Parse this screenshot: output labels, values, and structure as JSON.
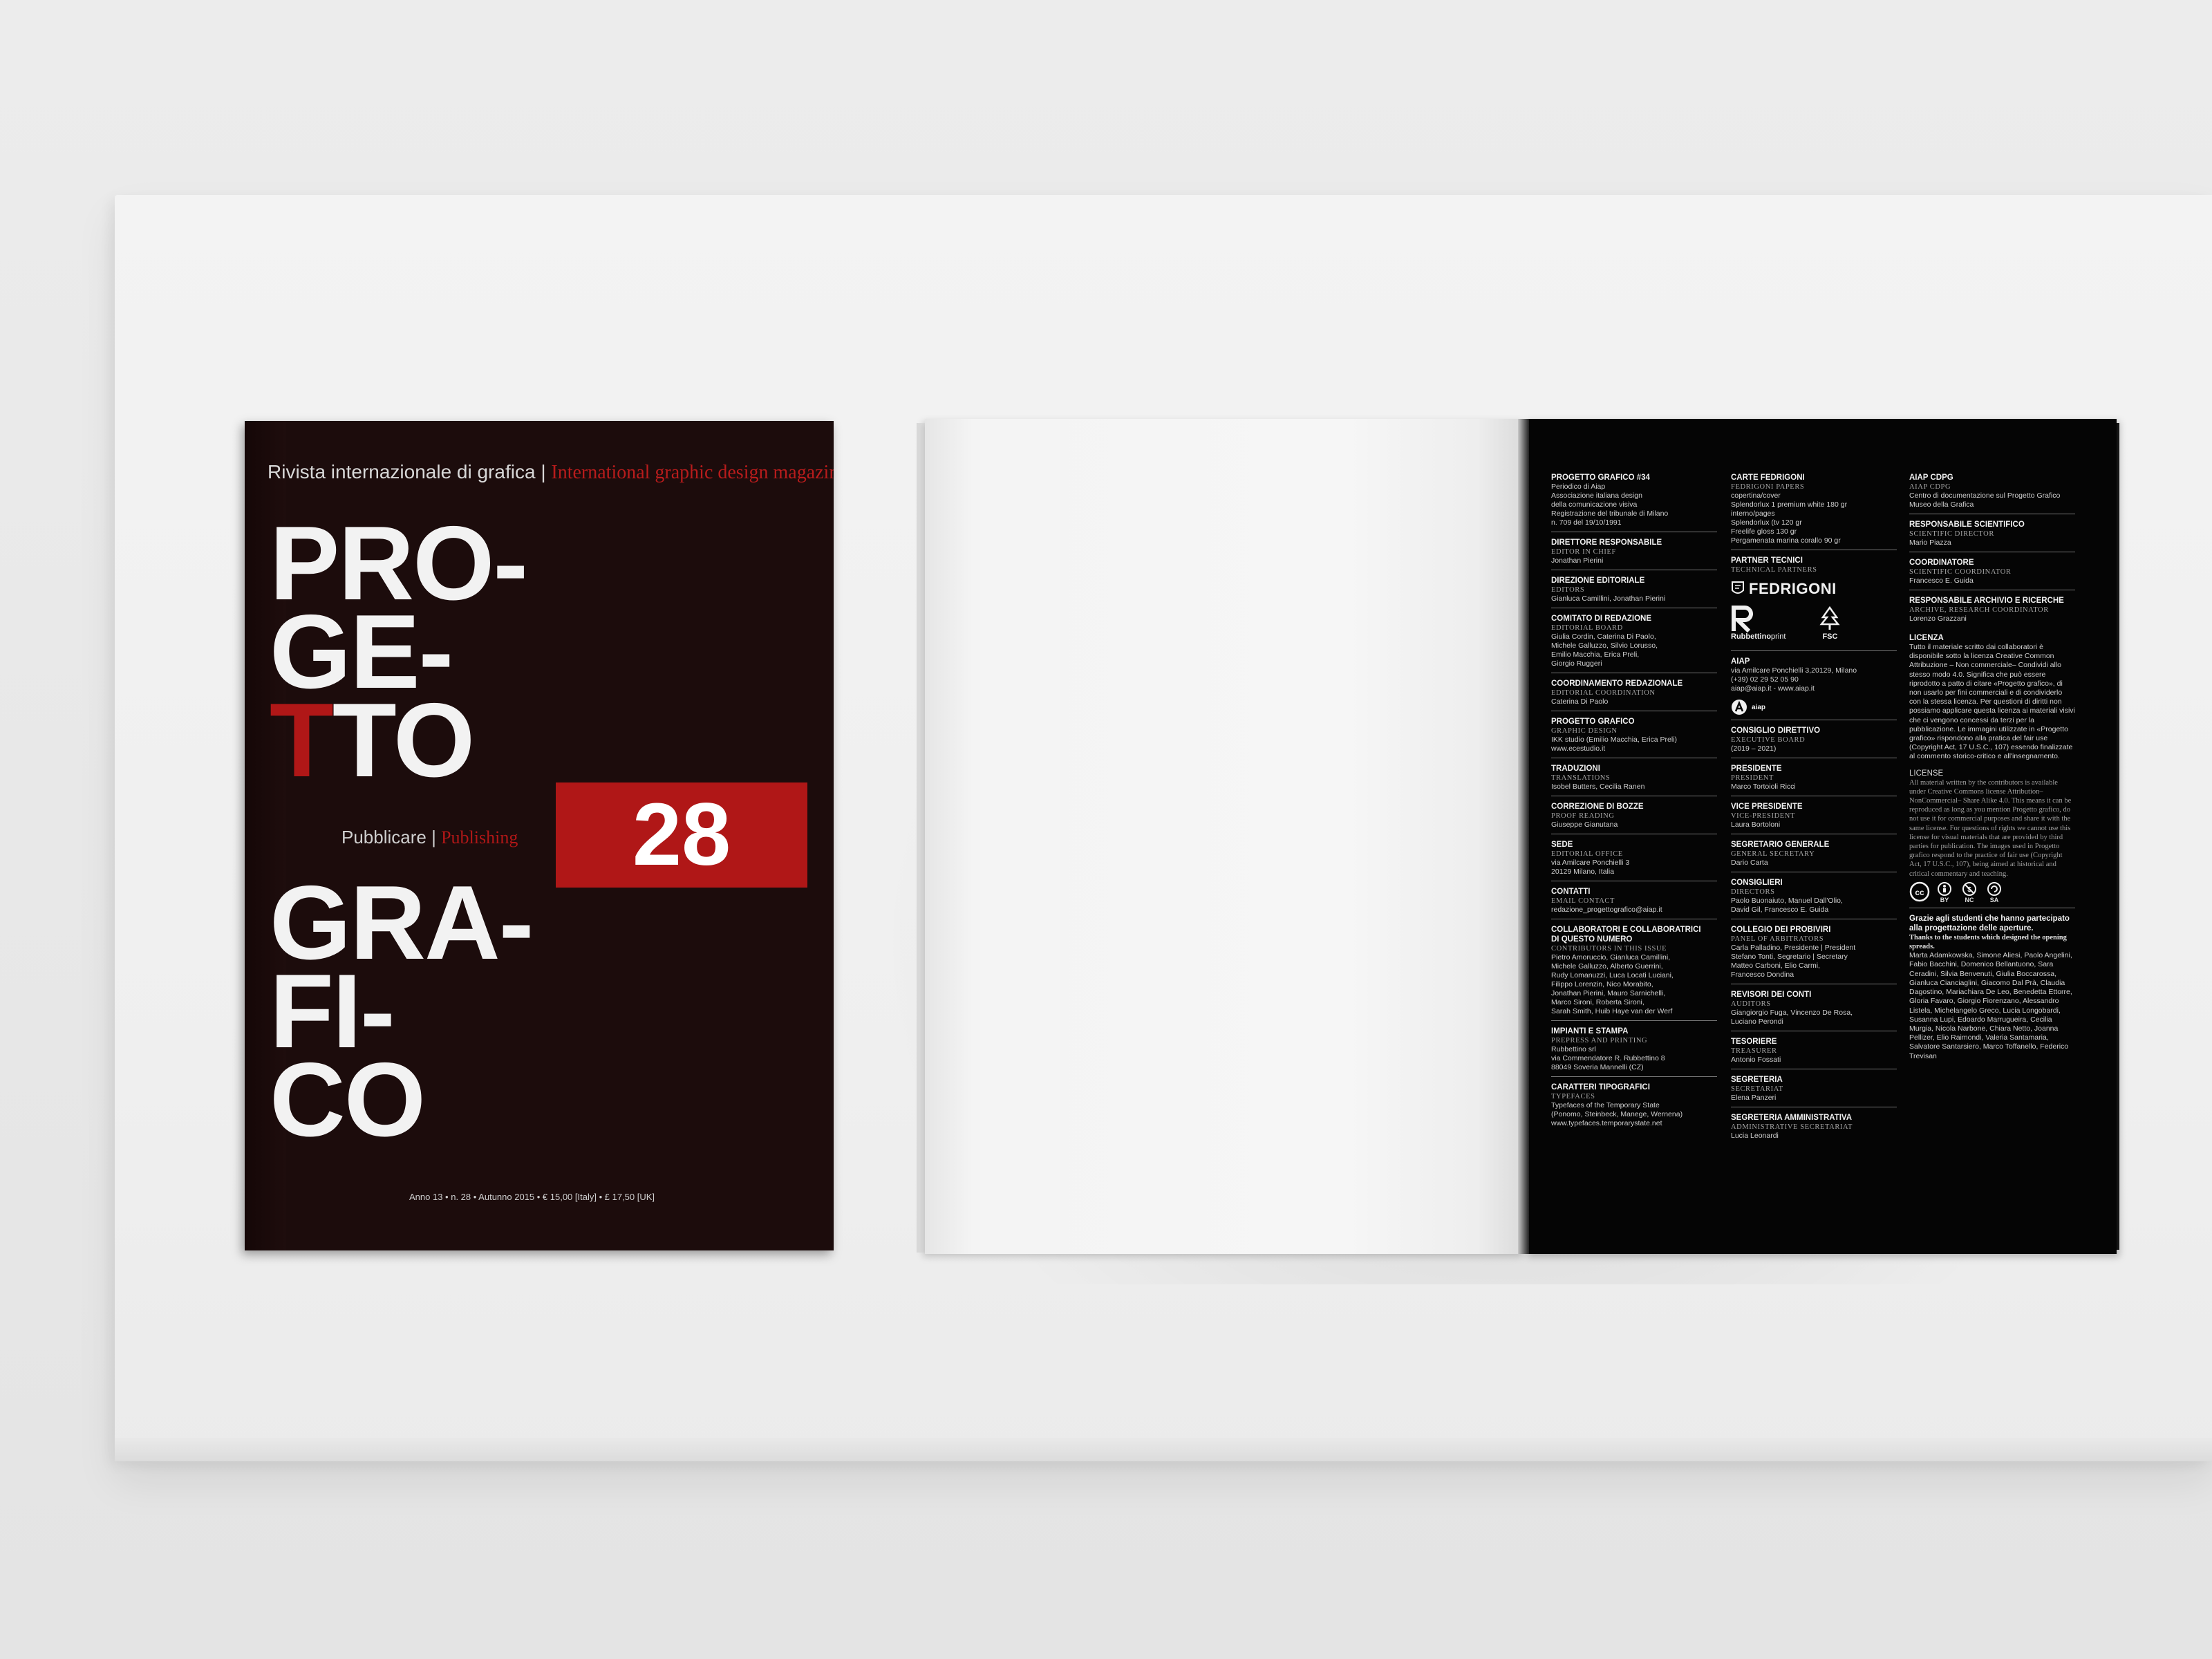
{
  "cover": {
    "tagline_it": "Rivista internazionale di grafica",
    "tagline_sep": "|",
    "tagline_en": "International graphic design magazine",
    "title_lines": [
      "PRO-",
      "GE-",
      "T",
      "TO",
      "GRA-",
      "FI-",
      "CO"
    ],
    "issue_number": "28",
    "section_it": "Pubblicare",
    "section_sep": "|",
    "section_en": "Publishing",
    "issue_line": "Anno 13 • n. 28 • Autunno 2015 • € 15,00 [Italy] • £ 17,50 [UK]",
    "colors": {
      "background": "#1c0c0c",
      "accent": "#b01717",
      "text": "#f2f2f2"
    }
  },
  "colophon": {
    "col1": [
      {
        "h": "PROGETTO GRAFICO #34",
        "s": "",
        "b": "Periodico di Aiap\nAssociazione italiana design\ndella comunicazione visiva\nRegistrazione del tribunale di Milano\nn. 709 del 19/10/1991"
      },
      {
        "h": "DIRETTORE RESPONSABILE",
        "s": "EDITOR IN CHIEF",
        "b": "Jonathan Pierini"
      },
      {
        "h": "DIREZIONE EDITORIALE",
        "s": "EDITORS",
        "b": "Gianluca Camillini, Jonathan Pierini"
      },
      {
        "h": "COMITATO DI REDAZIONE",
        "s": "EDITORIAL BOARD",
        "b": "Giulia Cordin, Caterina Di Paolo,\nMichele Galluzzo, Silvio Lorusso,\nEmilio Macchia, Erica Preli,\nGiorgio Ruggeri"
      },
      {
        "h": "COORDINAMENTO REDAZIONALE",
        "s": "EDITORIAL COORDINATION",
        "b": "Caterina Di Paolo"
      },
      {
        "h": "PROGETTO GRAFICO",
        "s": "GRAPHIC DESIGN",
        "b": "IKK studio (Emilio Macchia, Erica Preli)\nwww.ecestudio.it"
      },
      {
        "h": "TRADUZIONI",
        "s": "TRANSLATIONS",
        "b": "Isobel Butters, Cecilia Ranen"
      },
      {
        "h": "CORREZIONE DI BOZZE",
        "s": "PROOF READING",
        "b": "Giuseppe Gianutana"
      },
      {
        "h": "SEDE",
        "s": "EDITORIAL OFFICE",
        "b": "via Amilcare Ponchielli 3\n20129 Milano, Italia"
      },
      {
        "h": "CONTATTI",
        "s": "EMAIL CONTACT",
        "b": "redazione_progettografico@aiap.it"
      },
      {
        "h": "COLLABORATORI E COLLABORATRICI\nDI QUESTO NUMERO",
        "s": "CONTRIBUTORS IN THIS ISSUE",
        "b": "Pietro Amoruccio, Gianluca Camillini,\nMichele Galluzzo, Alberto Guerrini,\nRudy Lomanuzzi, Luca Locati Luciani,\nFilippo Lorenzin, Nico Morabito,\nJonathan Pierini, Mauro Sarnichelli,\nMarco Sironi, Roberta Sironi,\nSarah Smith, Huib Haye van der Werf"
      },
      {
        "h": "IMPIANTI E STAMPA",
        "s": "PREPRESS AND PRINTING",
        "b": "Rubbettino srl\nvia Commendatore R. Rubbettino 8\n88049 Soveria Mannelli (CZ)"
      },
      {
        "h": "CARATTERI TIPOGRAFICI",
        "s": "TYPEFACES",
        "b": "Typefaces of the Temporary State\n(Ponomo, Steinbeck, Manege, Wernena)\nwww.typefaces.temporarystate.net"
      }
    ],
    "col2": [
      {
        "h": "CARTE FEDRIGONI",
        "s": "FEDRIGONI PAPERS",
        "b": "copertina/cover\nSplendorlux 1 premium white 180 gr\ninterno/pages\nSplendorlux (tv 120 gr\nFreelife gloss 130 gr\nPergamenata marina corallo 90 gr"
      },
      {
        "h": "PARTNER TECNICI",
        "s": "TECHNICAL PARTNERS",
        "b": ""
      },
      {
        "h": "AIAP",
        "s": "",
        "b": "via Amilcare Ponchielli 3,20129, Milano\n(+39) 02 29 52 05 90\naiap@aiap.it - www.aiap.it"
      },
      {
        "h": "CONSIGLIO DIRETTIVO",
        "s": "EXECUTIVE BOARD",
        "b": "(2019 – 2021)"
      },
      {
        "h": "PRESIDENTE",
        "s": "PRESIDENT",
        "b": "Marco Tortoioli Ricci"
      },
      {
        "h": "VICE PRESIDENTE",
        "s": "VICE-PRESIDENT",
        "b": "Laura Bortoloni"
      },
      {
        "h": "SEGRETARIO GENERALE",
        "s": "GENERAL SECRETARY",
        "b": "Dario Carta"
      },
      {
        "h": "CONSIGLIERI",
        "s": "DIRECTORS",
        "b": "Paolo Buonaiuto, Manuel Dall'Olio,\nDavid Gil, Francesco E. Guida"
      },
      {
        "h": "COLLEGIO DEI PROBIVIRI",
        "s": "PANEL OF ARBITRATORS",
        "b": "Carla Palladino, Presidente | President\nStefano Tonti, Segretario | Secretary\nMatteo Carboni, Elio Carmi,\nFrancesco Dondina"
      },
      {
        "h": "REVISORI DEI CONTI",
        "s": "AUDITORS",
        "b": "Giangiorgio Fuga, Vincenzo De Rosa,\nLuciano Perondi"
      },
      {
        "h": "TESORIERE",
        "s": "TREASURER",
        "b": "Antonio Fossati"
      },
      {
        "h": "SEGRETERIA",
        "s": "SECRETARIAT",
        "b": "Elena Panzeri"
      },
      {
        "h": "SEGRETERIA AMMINISTRATIVA",
        "s": "ADMINISTRATIVE SECRETARIAT",
        "b": "Lucia Leonardi"
      }
    ],
    "logos": {
      "fedrigoni": "FEDRIGONI",
      "rubbettino": "Rubbettino",
      "rubbettino_sub": "print",
      "fsc": "FSC",
      "aiap": "aiap"
    },
    "col3": [
      {
        "h": "AIAP CDPG",
        "s": "AIAP CDPG",
        "b": "Centro di documentazione sul Progetto Grafico\nMuseo della Grafica"
      },
      {
        "h": "RESPONSABILE SCIENTIFICO",
        "s": "SCIENTIFIC DIRECTOR",
        "b": "Mario Piazza"
      },
      {
        "h": "COORDINATORE",
        "s": "SCIENTIFIC COORDINATOR",
        "b": "Francesco E. Guida"
      },
      {
        "h": "RESPONSABILE ARCHIVIO E RICERCHE",
        "s": "ARCHIVE, RESEARCH COORDINATOR",
        "b": "Lorenzo Grazzani"
      }
    ],
    "license_h": "LICENZA",
    "license_it": "Tutto il materiale scritto dai collaboratori è disponibile sotto la licenza Creative Common Attribuzione – Non commerciale– Condividi allo stesso modo 4.0. Significa che può essere riprodotto a patto di citare «Progetto grafico», di non usarlo per fini commerciali e di condividerlo con la stessa licenza. Per questioni di diritti non possiamo applicare questa licenza ai materiali visivi che ci vengono concessi da terzi per la pubblicazione. Le immagini utilizzate in «Progetto grafico» rispondono alla pratica del fair use (Copyright Act, 17 U.S.C., 107) essendo finalizzate al commento storico-critico e all'insegnamento.",
    "license_en_h": "LICENSE",
    "license_en": "All material written by the contributors is available under Creative Commons license Attribution–NonCommercial– Share Alike 4.0. This means it can be reproduced as long as you mention Progetto grafico, do not use it for commercial purposes and share it with the same license. For questions of rights we cannot use this license for visual materials that are provided by third parties for publication. The images used in Progetto grafico respond to the practice of fair use (Copyright Act, 17 U.S.C., 107), being aimed at historical and critical commentary and teaching.",
    "cc_labels": [
      "BY",
      "NC",
      "SA"
    ],
    "thanks_h": "Grazie agli studenti che hanno partecipato alla progettazione delle aperture.",
    "thanks_en": "Thanks to the students which designed the opening spreads.",
    "thanks_names": "Marta Adamkowska, Simone Aliesi, Paolo Angelini, Fabio Bacchini, Domenico Bellantuono, Sara Ceradini, Silvia Benvenuti, Giulia Boccarossa, Gianluca Cianciaglini, Giacomo Dal Prà, Claudia Dagostino, Mariachiara De Leo, Benedetta Ettorre, Gloria Favaro, Giorgio Fiorenzano, Alessandro Listela, Michelangelo Greco, Lucia Longobardi, Susanna Lupi, Edoardo Marrugueira, Cecilia Murgia, Nicola Narbone, Chiara Netto, Joanna Pellizer, Elio Raimondi, Valeria Santamaria, Salvatore Santarsiero, Marco Toffanello, Federico Trevisan"
  }
}
